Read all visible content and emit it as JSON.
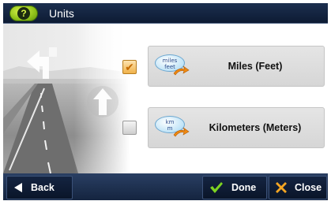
{
  "window": {
    "title": "Units"
  },
  "options": [
    {
      "label": "Miles (Feet)",
      "icon_text": [
        "miles",
        "feet"
      ],
      "checked": true,
      "icon": "miles-feet-bubble-icon"
    },
    {
      "label": "Kilometers (Meters)",
      "icon_text": [
        "km",
        "m"
      ],
      "checked": false,
      "icon": "km-m-bubble-icon"
    }
  ],
  "footer": {
    "back_label": "Back",
    "done_label": "Done",
    "close_label": "Close"
  },
  "colors": {
    "titlebar": "#0d1b33",
    "help_button": "#8fc21a",
    "option_bg": "#dcdcdc",
    "done_check": "#7ed321",
    "close_x": "#f5a623",
    "checked_box": "#f0b24a"
  }
}
